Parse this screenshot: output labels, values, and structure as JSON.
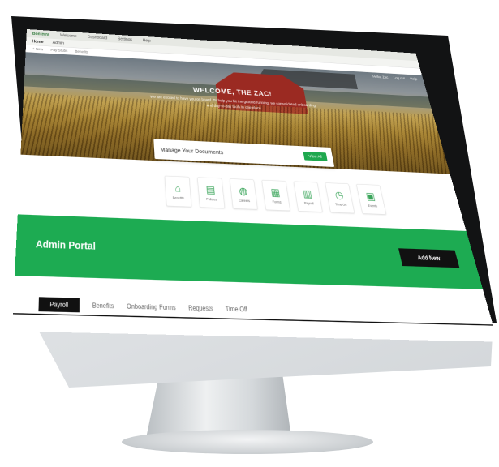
{
  "os_bar": {
    "brand": "Bonterra",
    "items": [
      "Welcome",
      "Dashboard",
      "Settings",
      "Help"
    ]
  },
  "app_bar": {
    "items": [
      "Home",
      "Admin"
    ],
    "selected": "Home"
  },
  "toolbar": {
    "items": [
      "+ New",
      "Pay Stubs",
      "Benefits"
    ]
  },
  "header_links": [
    "Hello, Zac",
    "Log out",
    "Help"
  ],
  "hero": {
    "title": "WELCOME, THE ZAC!",
    "subtitle": "We are excited to have you on board. To help you hit the ground running, we consolidated onboarding and day-to-day tools in one place."
  },
  "documents": {
    "label": "Manage Your Documents",
    "button": "View All"
  },
  "quick_links": [
    {
      "icon": "home-icon",
      "glyph": "⌂",
      "label": "Benefits"
    },
    {
      "icon": "document-icon",
      "glyph": "▤",
      "label": "Policies"
    },
    {
      "icon": "globe-icon",
      "glyph": "◍",
      "label": "Careers"
    },
    {
      "icon": "form-icon",
      "glyph": "▦",
      "label": "Forms"
    },
    {
      "icon": "payroll-icon",
      "glyph": "▥",
      "label": "Payroll"
    },
    {
      "icon": "clock-icon",
      "glyph": "◷",
      "label": "Time Off"
    },
    {
      "icon": "calendar-icon",
      "glyph": "▣",
      "label": "Events"
    }
  ],
  "portal": {
    "title": "Admin Portal",
    "add_button": "Add New"
  },
  "tabs": [
    "Payroll",
    "Benefits",
    "Onboarding Forms",
    "Requests",
    "Time Off"
  ],
  "colors": {
    "accent": "#1dab52",
    "dark": "#111111",
    "barn": "#9b2a22"
  }
}
